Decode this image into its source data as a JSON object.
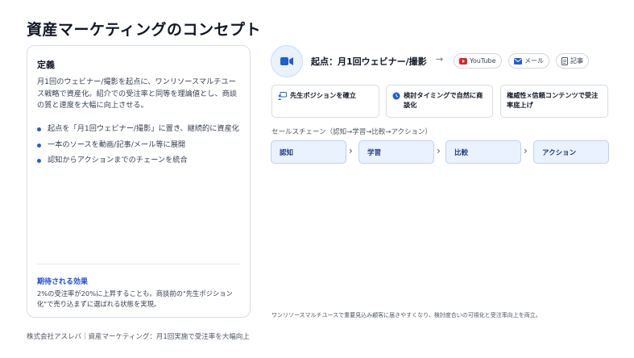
{
  "title": "資産マーケティングのコンセプト",
  "left": {
    "heading": "定義",
    "description": "月1回のウェビナー/撮影を起点に、ワンリソースマルチユース戦略で資産化。紹介での受注率と同等を理論値とし、商談の質と速度を大幅に向上させる。",
    "bullets": [
      "起点を「月1回ウェビナー/撮影」に置き、継続的に資産化",
      "一本のソースを動画/記事/メール等に展開",
      "認知からアクションまでのチェーンを統合"
    ],
    "effect_heading": "期待される効果",
    "effect_text": "2%の受注率が20%に上昇することも。商談前の\"先生ポジション化\"で売り込まずに選ばれる状態を実現。"
  },
  "footer": "株式会社アスレバ｜資産マーケティング：月1回実施で受注率を大幅向上",
  "right": {
    "origin_label": "起点：月1回ウェビナー/撮影",
    "arrow": "→",
    "channels": [
      "YouTube",
      "メール",
      "記事"
    ],
    "features": [
      "先生ポジションを確立",
      "検討タイミングで自然に商談化",
      "権威性×信頼コンテンツで受注率底上げ"
    ],
    "chain_label": "セールスチェーン（認知→学習→比較→アクション）",
    "steps": [
      "認知",
      "学習",
      "比較",
      "アクション"
    ],
    "note": "ワンリソースマルチユースで重要見込み顧客に届きやすくなり、検討度合いの可視化と受注率向上を両立。"
  },
  "colors": {
    "accent": "#1d5fd6",
    "step_bg": "#eaf2fd",
    "youtube": "#e02424"
  },
  "icons": [
    "video-camera-icon",
    "youtube-icon",
    "mail-icon",
    "document-icon",
    "presenter-icon",
    "clock-icon"
  ]
}
